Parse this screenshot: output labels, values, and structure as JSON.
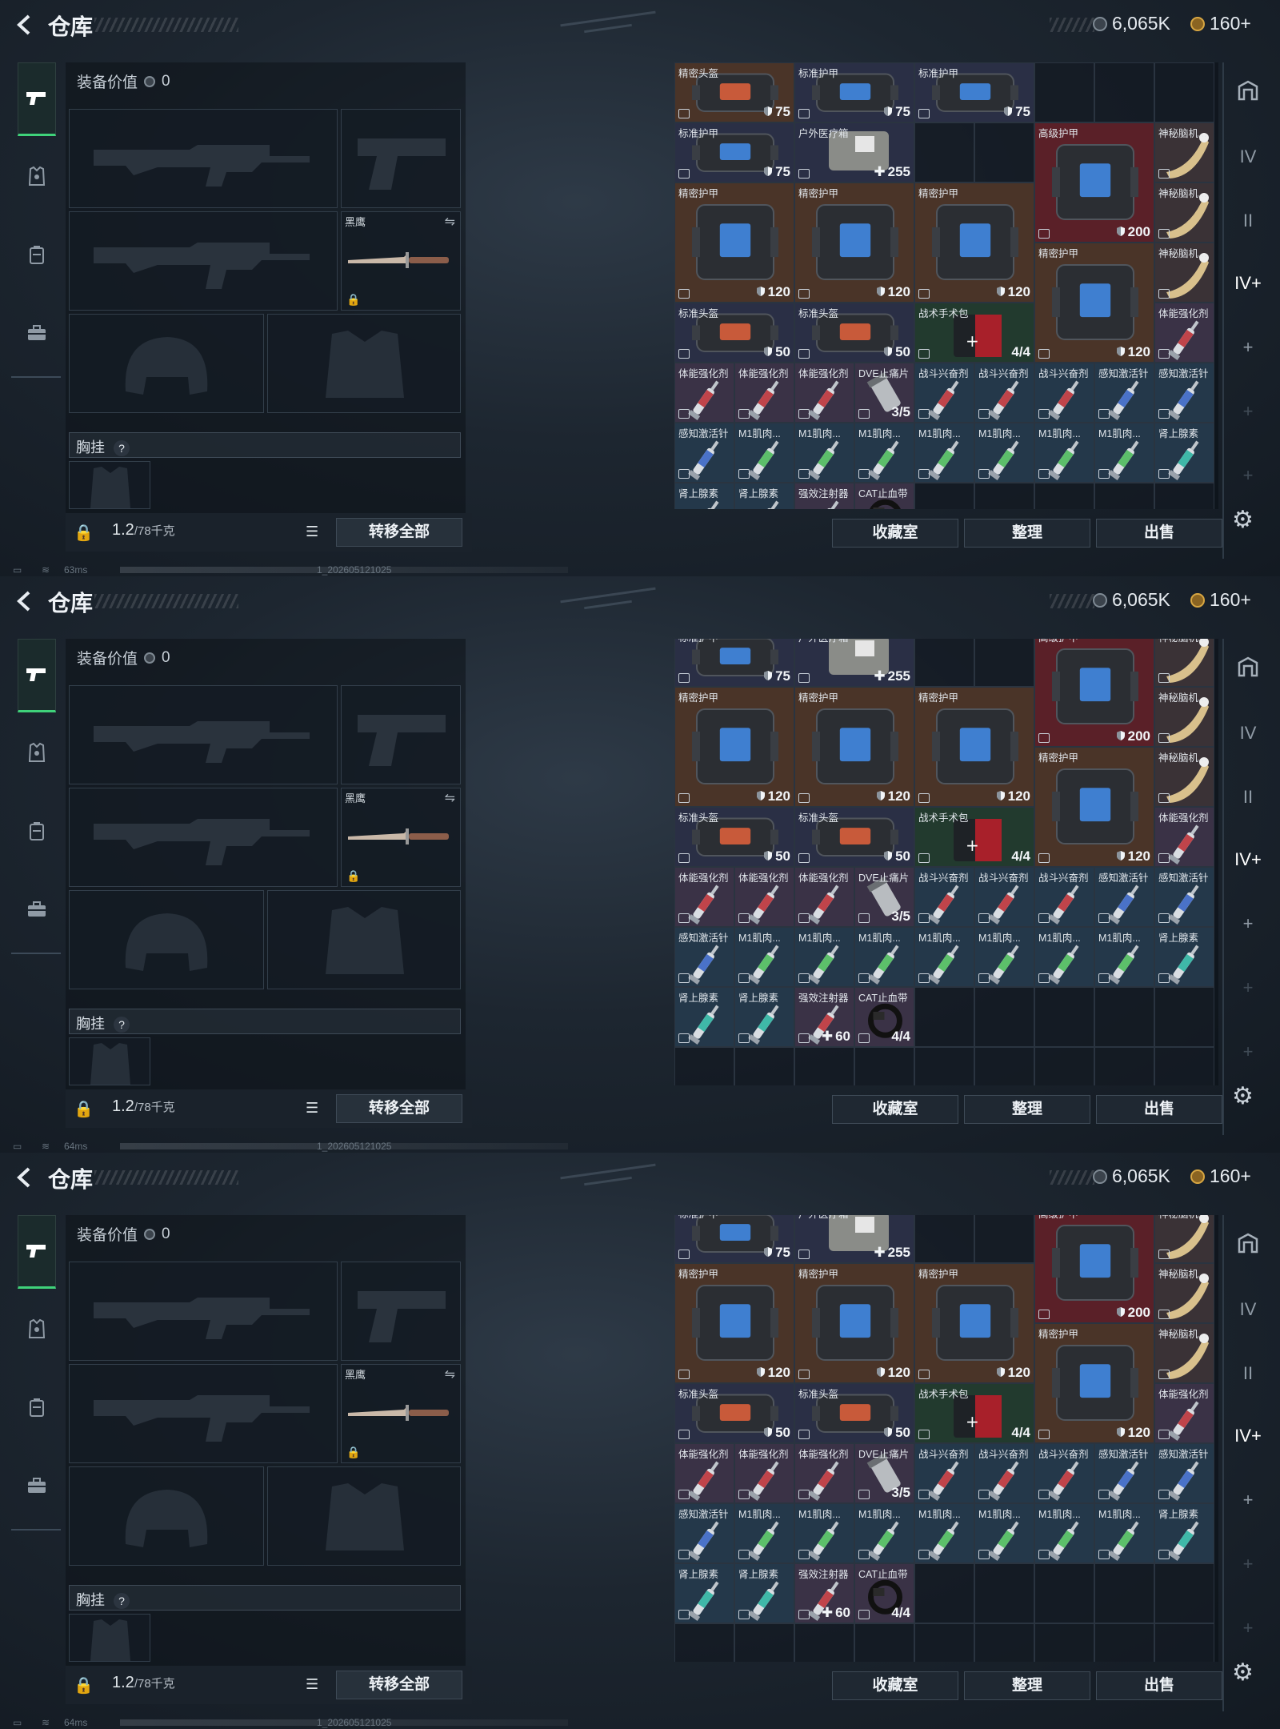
{
  "frames": [
    {
      "stash_scroll": 0
    },
    {
      "stash_scroll": 1
    },
    {
      "stash_scroll": 1
    }
  ],
  "header": {
    "title": "仓库",
    "currency_silver": "6,065K",
    "currency_gold": "160+"
  },
  "loadout": {
    "equipment_value_label": "装备价值",
    "equipment_value": "0",
    "melee_name": "黑鹰",
    "chest_rig_label": "胸挂",
    "chest_rig_help": "?",
    "weight_value": "1.2",
    "weight_unit": "/78千克",
    "transfer_all": "转移全部"
  },
  "stash": {
    "buttons": {
      "vault": "收藏室",
      "sort": "整理",
      "sell": "出售"
    },
    "items": [
      {
        "name": "精密头盔",
        "stat": "75",
        "kind": "helmet",
        "bg": "#4a3428",
        "c": 0,
        "r": 0,
        "w": 2,
        "h": 1,
        "icon": "shield"
      },
      {
        "name": "标准护甲",
        "stat": "75",
        "kind": "armor",
        "bg": "#2a2f45",
        "c": 2,
        "r": 0,
        "w": 2,
        "h": 1,
        "icon": "shield"
      },
      {
        "name": "标准护甲",
        "stat": "75",
        "kind": "armor",
        "bg": "#2a2f45",
        "c": 4,
        "r": 0,
        "w": 2,
        "h": 1,
        "icon": "shield"
      },
      {
        "name": "标准护甲",
        "stat": "75",
        "kind": "armor",
        "bg": "#2a2f45",
        "c": 0,
        "r": 1,
        "w": 2,
        "h": 1,
        "icon": "shield"
      },
      {
        "name": "户外医疗箱",
        "stat": "255",
        "kind": "medkit",
        "bg": "#2a2f45",
        "c": 2,
        "r": 1,
        "w": 2,
        "h": 1,
        "icon": "plus"
      },
      {
        "name": "高级护甲",
        "stat": "200",
        "kind": "armor",
        "bg": "#5a2028",
        "c": 6,
        "r": 1,
        "w": 2,
        "h": 2,
        "icon": "shield"
      },
      {
        "name": "神秘脑机...",
        "stat": "",
        "kind": "horn",
        "bg": "#3a3236",
        "c": 8,
        "r": 1,
        "w": 1,
        "h": 1,
        "icon": ""
      },
      {
        "name": "精密护甲",
        "stat": "120",
        "kind": "armor",
        "bg": "#4a3428",
        "c": 0,
        "r": 2,
        "w": 2,
        "h": 2,
        "icon": "shield"
      },
      {
        "name": "精密护甲",
        "stat": "120",
        "kind": "armor",
        "bg": "#4a3428",
        "c": 2,
        "r": 2,
        "w": 2,
        "h": 2,
        "icon": "shield"
      },
      {
        "name": "精密护甲",
        "stat": "120",
        "kind": "armor",
        "bg": "#4a3428",
        "c": 4,
        "r": 2,
        "w": 2,
        "h": 2,
        "icon": "shield"
      },
      {
        "name": "神秘脑机...",
        "stat": "",
        "kind": "horn",
        "bg": "#3a3236",
        "c": 8,
        "r": 2,
        "w": 1,
        "h": 1,
        "icon": ""
      },
      {
        "name": "精密护甲",
        "stat": "120",
        "kind": "armor",
        "bg": "#4a3428",
        "c": 6,
        "r": 3,
        "w": 2,
        "h": 2,
        "icon": "shield"
      },
      {
        "name": "神秘脑机...",
        "stat": "",
        "kind": "horn",
        "bg": "#3a3236",
        "c": 8,
        "r": 3,
        "w": 1,
        "h": 1,
        "icon": ""
      },
      {
        "name": "标准头盔",
        "stat": "50",
        "kind": "helmet",
        "bg": "#2a2f45",
        "c": 0,
        "r": 4,
        "w": 2,
        "h": 1,
        "icon": "shield"
      },
      {
        "name": "标准头盔",
        "stat": "50",
        "kind": "helmet",
        "bg": "#2a2f45",
        "c": 2,
        "r": 4,
        "w": 2,
        "h": 1,
        "icon": "shield"
      },
      {
        "name": "战术手术包",
        "stat": "4/4",
        "kind": "surgery",
        "bg": "#223a2e",
        "c": 4,
        "r": 4,
        "w": 2,
        "h": 1,
        "icon": ""
      },
      {
        "name": "体能强化剂",
        "stat": "",
        "kind": "syringe-red",
        "bg": "#3a3246",
        "c": 8,
        "r": 4,
        "w": 1,
        "h": 1,
        "icon": ""
      },
      {
        "name": "体能强化剂",
        "stat": "",
        "kind": "syringe-red",
        "bg": "#3a3246",
        "c": 0,
        "r": 5,
        "w": 1,
        "h": 1,
        "icon": ""
      },
      {
        "name": "体能强化剂",
        "stat": "",
        "kind": "syringe-red",
        "bg": "#3a3246",
        "c": 1,
        "r": 5,
        "w": 1,
        "h": 1,
        "icon": ""
      },
      {
        "name": "体能强化剂",
        "stat": "",
        "kind": "syringe-red",
        "bg": "#3a3246",
        "c": 2,
        "r": 5,
        "w": 1,
        "h": 1,
        "icon": ""
      },
      {
        "name": "DVE止痛片",
        "stat": "3/5",
        "kind": "pills",
        "bg": "#3a3246",
        "c": 3,
        "r": 5,
        "w": 1,
        "h": 1,
        "icon": ""
      },
      {
        "name": "战斗兴奋剂",
        "stat": "",
        "kind": "syringe-red",
        "bg": "#24384a",
        "c": 4,
        "r": 5,
        "w": 1,
        "h": 1,
        "icon": ""
      },
      {
        "name": "战斗兴奋剂",
        "stat": "",
        "kind": "syringe-red",
        "bg": "#24384a",
        "c": 5,
        "r": 5,
        "w": 1,
        "h": 1,
        "icon": ""
      },
      {
        "name": "战斗兴奋剂",
        "stat": "",
        "kind": "syringe-red",
        "bg": "#24384a",
        "c": 6,
        "r": 5,
        "w": 1,
        "h": 1,
        "icon": ""
      },
      {
        "name": "感知激活针",
        "stat": "",
        "kind": "syringe-blue",
        "bg": "#24384a",
        "c": 7,
        "r": 5,
        "w": 1,
        "h": 1,
        "icon": ""
      },
      {
        "name": "感知激活针",
        "stat": "",
        "kind": "syringe-blue",
        "bg": "#24384a",
        "c": 8,
        "r": 5,
        "w": 1,
        "h": 1,
        "icon": ""
      },
      {
        "name": "感知激活针",
        "stat": "",
        "kind": "syringe-blue",
        "bg": "#24384a",
        "c": 0,
        "r": 6,
        "w": 1,
        "h": 1,
        "icon": ""
      },
      {
        "name": "M1肌肉...",
        "stat": "",
        "kind": "syringe-green",
        "bg": "#24384a",
        "c": 1,
        "r": 6,
        "w": 1,
        "h": 1,
        "icon": ""
      },
      {
        "name": "M1肌肉...",
        "stat": "",
        "kind": "syringe-green",
        "bg": "#24384a",
        "c": 2,
        "r": 6,
        "w": 1,
        "h": 1,
        "icon": ""
      },
      {
        "name": "M1肌肉...",
        "stat": "",
        "kind": "syringe-green",
        "bg": "#24384a",
        "c": 3,
        "r": 6,
        "w": 1,
        "h": 1,
        "icon": ""
      },
      {
        "name": "M1肌肉...",
        "stat": "",
        "kind": "syringe-green",
        "bg": "#24384a",
        "c": 4,
        "r": 6,
        "w": 1,
        "h": 1,
        "icon": ""
      },
      {
        "name": "M1肌肉...",
        "stat": "",
        "kind": "syringe-green",
        "bg": "#24384a",
        "c": 5,
        "r": 6,
        "w": 1,
        "h": 1,
        "icon": ""
      },
      {
        "name": "M1肌肉...",
        "stat": "",
        "kind": "syringe-green",
        "bg": "#24384a",
        "c": 6,
        "r": 6,
        "w": 1,
        "h": 1,
        "icon": ""
      },
      {
        "name": "M1肌肉...",
        "stat": "",
        "kind": "syringe-green",
        "bg": "#24384a",
        "c": 7,
        "r": 6,
        "w": 1,
        "h": 1,
        "icon": ""
      },
      {
        "name": "肾上腺素",
        "stat": "",
        "kind": "syringe-teal",
        "bg": "#24384a",
        "c": 8,
        "r": 6,
        "w": 1,
        "h": 1,
        "icon": ""
      },
      {
        "name": "肾上腺素",
        "stat": "",
        "kind": "syringe-teal",
        "bg": "#24384a",
        "c": 0,
        "r": 7,
        "w": 1,
        "h": 1,
        "icon": ""
      },
      {
        "name": "肾上腺素",
        "stat": "",
        "kind": "syringe-teal",
        "bg": "#24384a",
        "c": 1,
        "r": 7,
        "w": 1,
        "h": 1,
        "icon": ""
      },
      {
        "name": "强效注射器",
        "stat": "60",
        "kind": "syringe-red",
        "bg": "#3a3246",
        "c": 2,
        "r": 7,
        "w": 1,
        "h": 1,
        "icon": "plus"
      },
      {
        "name": "CAT止血带",
        "stat": "4/4",
        "kind": "tourniquet",
        "bg": "#3a3246",
        "c": 3,
        "r": 7,
        "w": 1,
        "h": 1,
        "icon": ""
      }
    ]
  },
  "status": [
    {
      "ping": "63ms",
      "build": "1_202605121025"
    },
    {
      "ping": "64ms",
      "build": "1_202605121025"
    },
    {
      "ping": "64ms",
      "build": "1_202605121025"
    }
  ]
}
